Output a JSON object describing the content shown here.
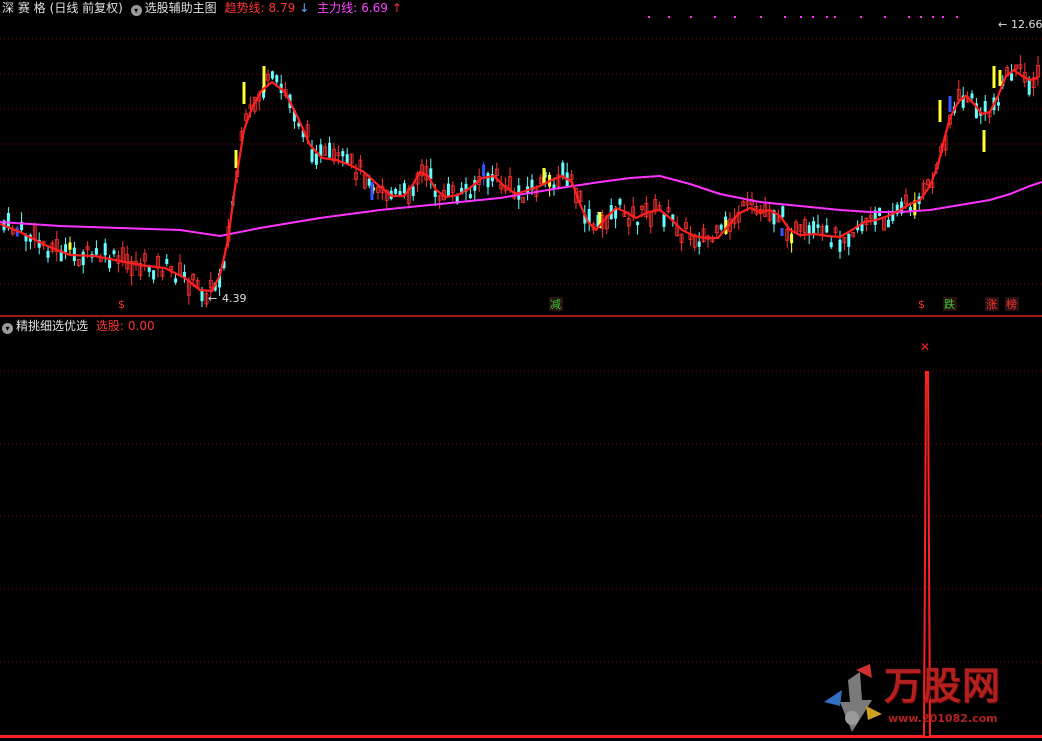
{
  "header_main": {
    "stock": "深 赛 格",
    "period": "(日线 前复权)",
    "indicator": "选股辅助主图",
    "trend_label": "趋势线:",
    "trend_value": "8.79",
    "trend_arrow": "↓",
    "main_label": "主力线:",
    "main_value": "6.69",
    "main_arrow": "↑"
  },
  "header_sub": {
    "indicator": "精挑细选优选",
    "pick_label": "选股:",
    "pick_value": "0.00"
  },
  "annotations": {
    "low_price": "4.39",
    "high_price": "12.66"
  },
  "signals": [
    {
      "text": "$",
      "color": "#ff3333"
    },
    {
      "text": "减",
      "color": "#33cc33"
    },
    {
      "text": "$",
      "color": "#ff3333"
    },
    {
      "text": "跌",
      "color": "#33cc33"
    },
    {
      "text": "涨",
      "color": "#ff3333"
    },
    {
      "text": "榜",
      "color": "#ff3333"
    }
  ],
  "watermark": {
    "text": "万股网",
    "url": "www.201082.com"
  },
  "colors": {
    "trend_line": "#ff2020",
    "main_line": "#ff33ff",
    "grid": "#8b0000",
    "up_candle": "#ff3333",
    "down_candle": "#66ffff",
    "yellow": "#ffff33",
    "blue": "#3355ff",
    "pick_line": "#ff2020"
  },
  "chart_data": {
    "type": "line",
    "series": [
      {
        "name": "趋势线",
        "last": 8.79
      },
      {
        "name": "主力线",
        "last": 6.69
      },
      {
        "name": "选股",
        "last": 0.0
      }
    ],
    "price_low": 4.39,
    "price_high": 12.66
  }
}
